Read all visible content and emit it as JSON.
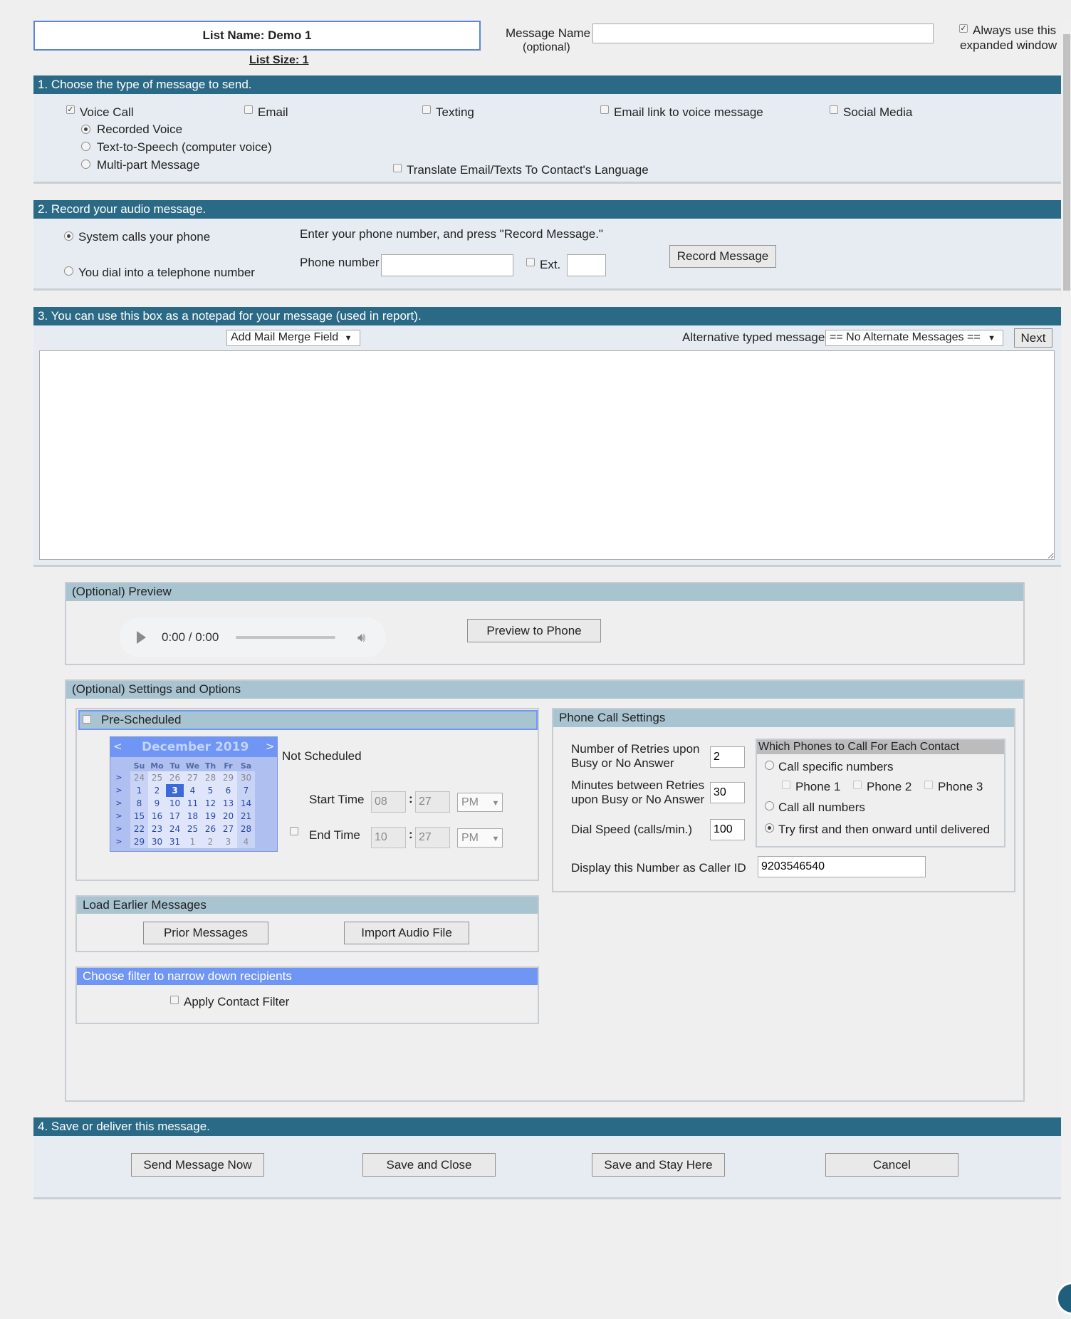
{
  "header": {
    "list_name": "List Name: Demo 1",
    "list_size": "List Size: 1",
    "message_name_label": "Message Name",
    "message_name_optional": "(optional)",
    "message_name_value": "",
    "always_expanded_line1": "Always use this",
    "always_expanded_line2": "expanded window",
    "always_expanded_checked": true
  },
  "section1": {
    "title": "1. Choose the type of message to send.",
    "types": [
      {
        "label": "Voice Call",
        "checked": true
      },
      {
        "label": "Email",
        "checked": false
      },
      {
        "label": "Texting",
        "checked": false
      },
      {
        "label": "Email link to voice message",
        "checked": false
      },
      {
        "label": "Social Media",
        "checked": false
      }
    ],
    "voice_options": [
      {
        "label": "Recorded Voice",
        "selected": true
      },
      {
        "label": "Text-to-Speech (computer voice)",
        "selected": false
      },
      {
        "label": "Multi-part Message",
        "selected": false
      }
    ],
    "translate_label": "Translate Email/Texts To Contact's Language"
  },
  "section2": {
    "title": "2. Record your audio message.",
    "option_system": "System calls your phone",
    "option_dial": "You dial into a telephone number",
    "instructions": "Enter your phone number, and press \"Record Message.\"",
    "phone_label": "Phone number",
    "ext_label": "Ext.",
    "record_button": "Record Message"
  },
  "section3": {
    "title": "3. You can use this box as a notepad for your message (used in report).",
    "mail_merge": "Add Mail Merge Field",
    "alt_label": "Alternative typed message.",
    "alt_select": "== No Alternate Messages ==",
    "next_button": "Next",
    "notepad_value": ""
  },
  "preview": {
    "title": "(Optional) Preview",
    "time": "0:00 / 0:00",
    "preview_button": "Preview to Phone"
  },
  "settings": {
    "title": "(Optional) Settings and Options",
    "prescheduled_label": "Pre-Scheduled",
    "not_scheduled": "Not Scheduled",
    "start_time_label": "Start Time",
    "start_hour": "08",
    "start_min": "27",
    "start_ampm": "PM",
    "end_time_label": "End Time",
    "end_hour": "10",
    "end_min": "27",
    "end_ampm": "PM",
    "calendar": {
      "month": "December 2019",
      "prev": "<",
      "next": ">",
      "days": [
        "Su",
        "Mo",
        "Tu",
        "We",
        "Th",
        "Fr",
        "Sa"
      ],
      "weeks": [
        [
          "24",
          "25",
          "26",
          "27",
          "28",
          "29",
          "30"
        ],
        [
          "1",
          "2",
          "3",
          "4",
          "5",
          "6",
          "7"
        ],
        [
          "8",
          "9",
          "10",
          "11",
          "12",
          "13",
          "14"
        ],
        [
          "15",
          "16",
          "17",
          "18",
          "19",
          "20",
          "21"
        ],
        [
          "22",
          "23",
          "24",
          "25",
          "26",
          "27",
          "28"
        ],
        [
          "29",
          "30",
          "31",
          "1",
          "2",
          "3",
          "4"
        ]
      ],
      "selected": "3"
    },
    "load_earlier_title": "Load Earlier Messages",
    "prior_button": "Prior Messages",
    "import_button": "Import Audio File",
    "filter_title": "Choose filter to narrow down recipients",
    "apply_filter": "Apply Contact Filter",
    "phone_settings_title": "Phone Call Settings",
    "retries_label1": "Number of Retries upon",
    "retries_label2": "Busy or No Answer",
    "retries_value": "2",
    "minutes_label1": "Minutes between Retries",
    "minutes_label2": "upon Busy or No Answer",
    "minutes_value": "30",
    "dial_speed_label": "Dial Speed (calls/min.)",
    "dial_speed_value": "100",
    "caller_id_label": "Display this Number as Caller ID",
    "caller_id_value": "9203546540",
    "which_phones_title": "Which Phones to Call For Each Contact",
    "call_specific": "Call specific numbers",
    "phone1": "Phone 1",
    "phone2": "Phone 2",
    "phone3": "Phone 3",
    "call_all": "Call all numbers",
    "try_first": "Try first and then onward until delivered"
  },
  "section4": {
    "title": "4. Save or deliver this message.",
    "send_now": "Send Message Now",
    "save_close": "Save and Close",
    "save_stay": "Save and Stay Here",
    "cancel": "Cancel"
  }
}
